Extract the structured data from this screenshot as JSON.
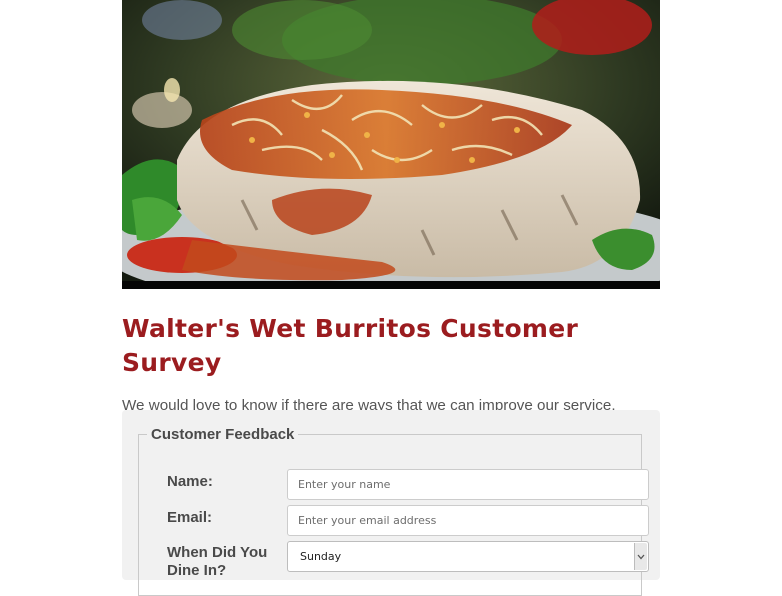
{
  "hero": {
    "image_alt": "burrito-photo"
  },
  "title": "Walter's Wet Burritos Customer Survey",
  "intro": "We would love to know if there are ways that we can improve our service. Please fill out the following survey to be entered into our monthly contest.",
  "form": {
    "legend": "Customer Feedback",
    "name_label": "Name:",
    "name_placeholder": "Enter your name",
    "email_label": "Email:",
    "email_placeholder": "Enter your email address",
    "dine_label_line1": "When Did You",
    "dine_label_line2": "Dine In?",
    "dine_selected": "Sunday"
  },
  "colors": {
    "title": "#9b1c1f",
    "text": "#555555",
    "panel": "#f1f1f1"
  }
}
